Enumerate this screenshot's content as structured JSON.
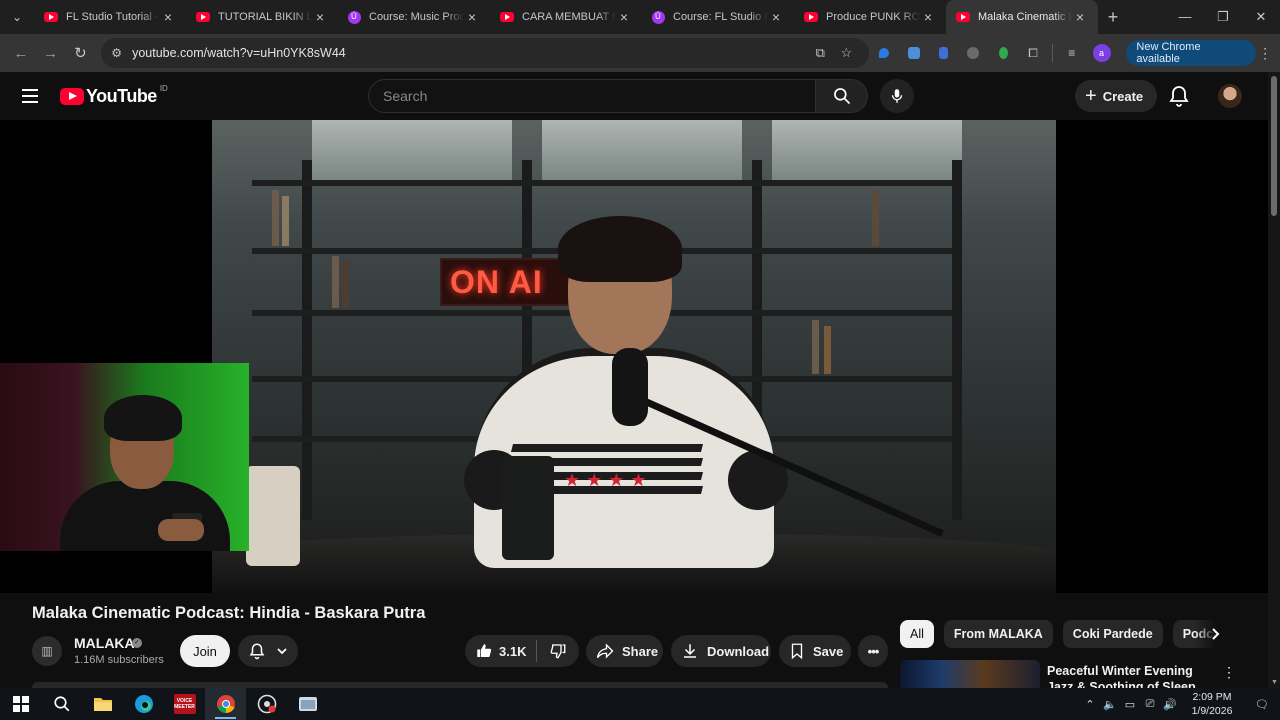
{
  "browser": {
    "tabs": [
      {
        "title": "FL Studio Tutorial - C",
        "favicon": "youtube-icon",
        "active": false
      },
      {
        "title": "TUTORIAL BIKIN LAG",
        "favicon": "youtube-icon",
        "active": false
      },
      {
        "title": "Course: Music Produ",
        "favicon": "udemy-icon",
        "active": false
      },
      {
        "title": "CARA MEMBUAT MU",
        "favicon": "youtube-icon",
        "active": false
      },
      {
        "title": "Course: FL Studio Int",
        "favicon": "udemy-icon",
        "active": false
      },
      {
        "title": "Produce PUNK ROCK",
        "favicon": "youtube-icon",
        "active": false
      },
      {
        "title": "Malaka Cinematic P",
        "favicon": "youtube-icon",
        "active": true
      }
    ],
    "url": "youtube.com/watch?v=uHn0YK8sW44",
    "profile_initial": "a",
    "update_label": "New Chrome available"
  },
  "youtube": {
    "logo_text": "YouTube",
    "country_code": "ID",
    "search_placeholder": "Search",
    "create_label": "Create"
  },
  "video": {
    "title": "Malaka Cinematic Podcast: Hindia - Baskara Putra",
    "neon_sign": "ON AI",
    "channel": {
      "name": "MALAKA",
      "subscribers": "1.16M subscribers",
      "verified": true
    },
    "join_label": "Join",
    "likes": "3.1K",
    "share_label": "Share",
    "download_label": "Download",
    "save_label": "Save"
  },
  "sidebar": {
    "chips": [
      {
        "label": "All",
        "selected": true
      },
      {
        "label": "From MALAKA",
        "selected": false
      },
      {
        "label": "Coki Pardede",
        "selected": false
      },
      {
        "label": "Podcasts",
        "selected": false
      }
    ],
    "related": [
      {
        "title": "Peaceful Winter Evening Jazz & Soothing of Sleep Jazz Pla"
      }
    ]
  },
  "taskbar": {
    "time": "2:09 PM",
    "date": "1/9/2026",
    "voicemeeter_label": "VOICE MEETER"
  },
  "colors": {
    "youtube_red": "#ff0033",
    "udemy_purple": "#a435f0",
    "background": "#0f0f0f",
    "chrome_update_blue": "#0f4a78"
  }
}
